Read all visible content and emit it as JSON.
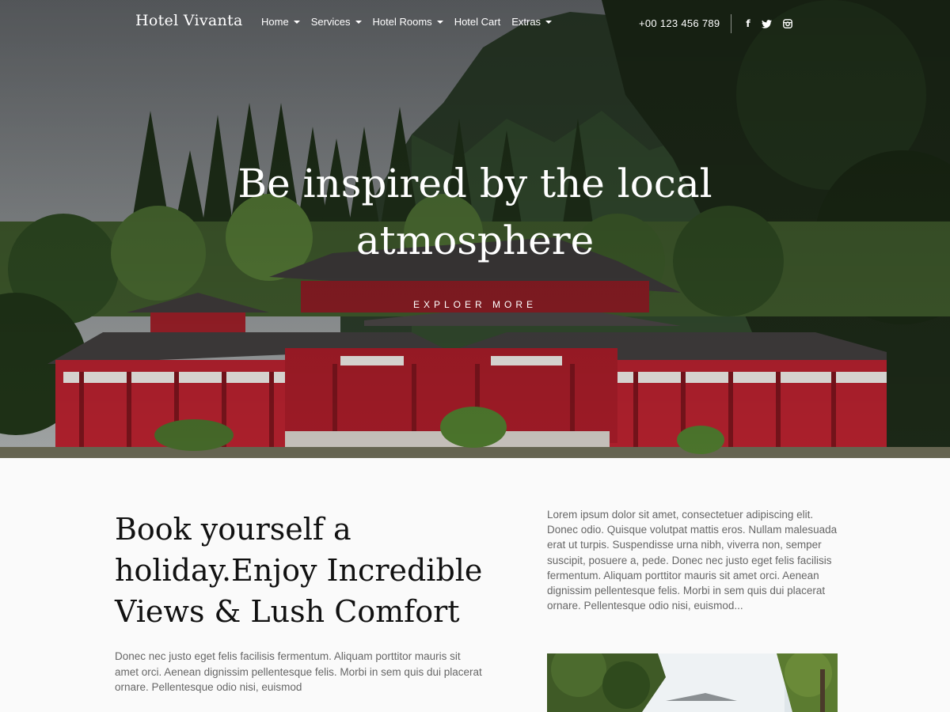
{
  "brand": {
    "name": "Hotel Vivanta"
  },
  "nav": {
    "items": [
      {
        "label": "Home",
        "dropdown": true
      },
      {
        "label": "Services",
        "dropdown": true
      },
      {
        "label": "Hotel Rooms",
        "dropdown": true
      },
      {
        "label": "Hotel Cart",
        "dropdown": false
      },
      {
        "label": "Extras",
        "dropdown": true
      }
    ]
  },
  "contact": {
    "phone": "+00 123 456 789"
  },
  "social": {
    "facebook_icon": "facebook-icon",
    "twitter_icon": "twitter-icon",
    "instagram_icon": "instagram-icon",
    "facebook_glyph": "f"
  },
  "hero": {
    "headline_line1": "Be inspired by the local",
    "headline_line2": "atmosphere",
    "cta_label": "EXPLOER MORE",
    "image": "temple-pagoda-mountain-photo"
  },
  "intro": {
    "title": "Book yourself a holiday.Enjoy Incredible Views & Lush Comfort",
    "body": "Donec nec justo eget felis facilisis fermentum. Aliquam porttitor mauris sit amet orci. Aenean dignissim pellentesque felis. Morbi in sem quis dui placerat ornare. Pellentesque odio nisi, euismod",
    "side_body": "Lorem ipsum dolor sit amet, consectetuer adipiscing elit. Donec odio. Quisque volutpat mattis eros. Nullam malesuada erat ut turpis. Suspendisse urna nibh, viverra non, semper suscipit, posuere a, pede. Donec nec justo eget felis facilisis fermentum. Aliquam porttitor mauris sit amet orci. Aenean dignissim pellentesque felis. Morbi in sem quis dui placerat ornare. Pellentesque odio nisi, euismod...",
    "side_image": "garden-trees-photo"
  },
  "colors": {
    "text_white": "#ffffff",
    "temple_red": "#b4212e",
    "content_bg": "#fafafa"
  }
}
